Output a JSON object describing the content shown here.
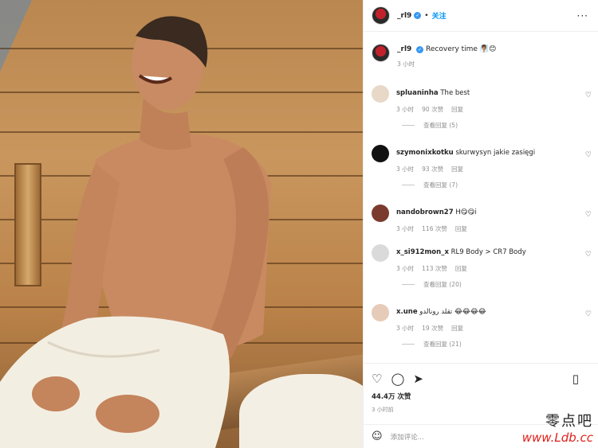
{
  "post": {
    "username": "_rl9",
    "follow_label": "关注",
    "more_icon": "more-horizontal-icon",
    "caption_text": "Recovery time 🧖🏽‍♂️😊",
    "caption_time": "3 小时"
  },
  "comments": [
    {
      "user": "spluaninha",
      "text": "The best",
      "time": "3 小时",
      "likes": "90 次赞",
      "reply": "回复",
      "replies": "查看回复 (5)",
      "avatar_color": "#e8d8c8"
    },
    {
      "user": "szymonixkotku",
      "text": "skurwysyn jakie zasięgi",
      "time": "3 小时",
      "likes": "93 次赞",
      "reply": "回复",
      "replies": "查看回复 (7)",
      "avatar_color": "#111111"
    },
    {
      "user": "nandobrown27",
      "text": "H😋😋i",
      "time": "3 小时",
      "likes": "116 次赞",
      "reply": "回复",
      "replies": "",
      "avatar_color": "#7a3b2e"
    },
    {
      "user": "x_si912mon_x",
      "text": "RL9 Body > CR7 Body",
      "time": "3 小时",
      "likes": "113 次赞",
      "reply": "回复",
      "replies": "查看回复 (20)",
      "avatar_color": "#dadada"
    },
    {
      "user": "x.une",
      "text": "تقلد رونالدو 😂😂😂😂",
      "time": "3 小时",
      "likes": "19 次赞",
      "reply": "回复",
      "replies": "查看回复 (21)",
      "avatar_color": "#e6cbb8"
    }
  ],
  "footer": {
    "likes": "44.4万 次赞",
    "time": "3 小时前",
    "add_comment_placeholder": "添加评论..."
  },
  "watermark": {
    "cn": "零点吧",
    "url": "www.Ldb.cc"
  }
}
